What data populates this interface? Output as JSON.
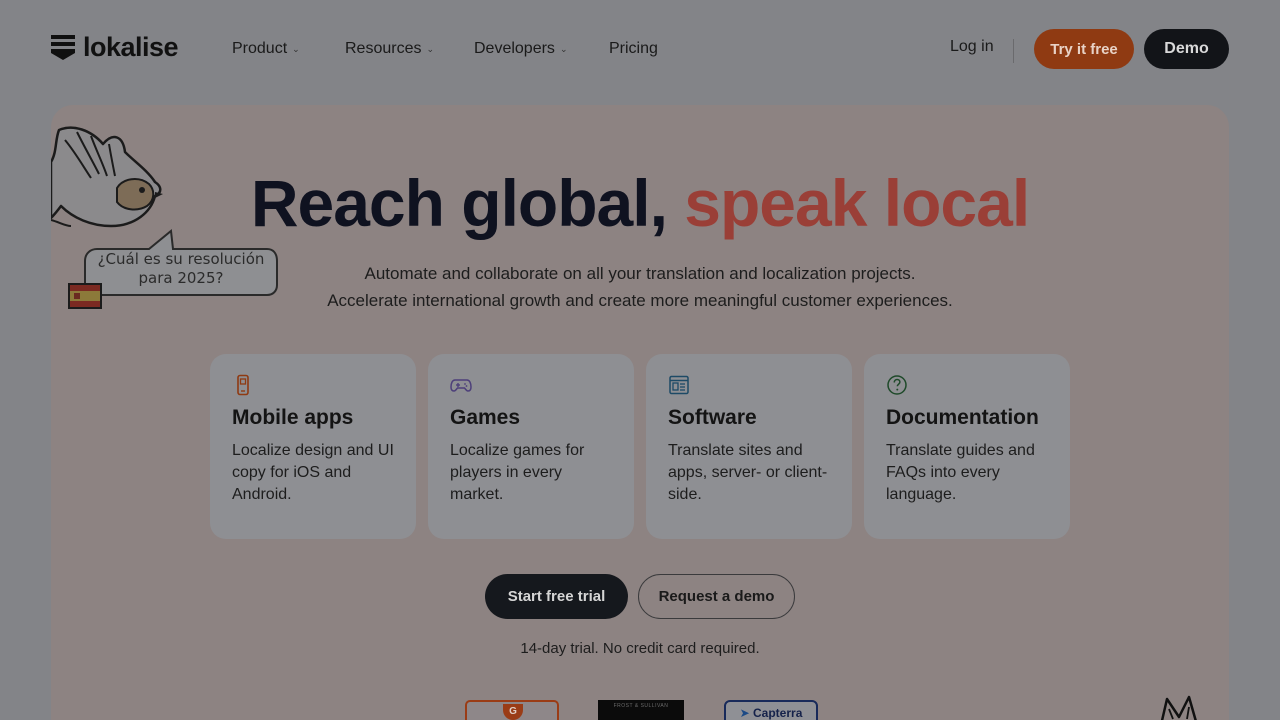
{
  "brand": {
    "name": "lokalise"
  },
  "nav": {
    "items": [
      {
        "label": "Product",
        "has_dropdown": true
      },
      {
        "label": "Resources",
        "has_dropdown": true
      },
      {
        "label": "Developers",
        "has_dropdown": true
      },
      {
        "label": "Pricing",
        "has_dropdown": false
      }
    ],
    "login": "Log in",
    "try_free": "Try it free",
    "demo": "Demo"
  },
  "hero": {
    "title_main": "Reach global,",
    "title_accent": "speak local",
    "subtitle_line1": "Automate and collaborate on all your translation and localization projects.",
    "subtitle_line2": "Accelerate international growth and create more meaningful customer experiences.",
    "illustration_bubble_line1": "¿Cuál es su resolución",
    "illustration_bubble_line2": "para 2025?"
  },
  "cards": [
    {
      "icon": "mobile-phone-icon",
      "title": "Mobile apps",
      "desc": "Localize design and UI copy for iOS and Android."
    },
    {
      "icon": "gamepad-icon",
      "title": "Games",
      "desc": "Localize games for players in every market."
    },
    {
      "icon": "browser-window-icon",
      "title": "Software",
      "desc": "Translate sites and apps, server- or client-side."
    },
    {
      "icon": "question-circle-icon",
      "title": "Documentation",
      "desc": "Translate guides and FAQs into every language."
    }
  ],
  "cta": {
    "start": "Start free trial",
    "request": "Request a demo",
    "note": "14-day trial. No credit card required."
  },
  "badges": {
    "g2": "G",
    "frost": "FROST & SULLIVAN",
    "capterra": "Capterra"
  },
  "colors": {
    "accent_orange": "#8f3a12",
    "dark": "#121418",
    "title_accent": "#9a3f37"
  }
}
